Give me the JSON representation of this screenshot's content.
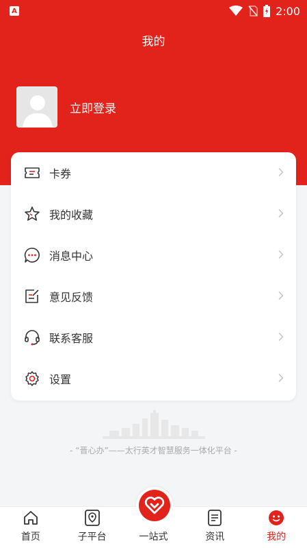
{
  "status_bar": {
    "app_badge": "A",
    "time": "2:00"
  },
  "header": {
    "title": "我的"
  },
  "profile": {
    "login_label": "立即登录"
  },
  "menu": {
    "items": [
      {
        "label": "卡券",
        "icon": "ticket-icon"
      },
      {
        "label": "我的收藏",
        "icon": "star-icon"
      },
      {
        "label": "消息中心",
        "icon": "message-icon"
      },
      {
        "label": "意见反馈",
        "icon": "feedback-icon"
      },
      {
        "label": "联系客服",
        "icon": "headset-icon"
      },
      {
        "label": "设置",
        "icon": "gear-icon"
      }
    ]
  },
  "footer": {
    "slogan": "- “晋心办”——太行英才智慧服务一体化平台 -"
  },
  "tabbar": {
    "tabs": [
      {
        "label": "首页",
        "icon": "home-icon"
      },
      {
        "label": "子平台",
        "icon": "location-icon"
      },
      {
        "label": "一站式",
        "icon": "heart-icon"
      },
      {
        "label": "资讯",
        "icon": "news-icon"
      },
      {
        "label": "我的",
        "icon": "profile-icon"
      }
    ],
    "active_index": 4
  },
  "colors": {
    "brand": "#e1231c",
    "background": "#f3f5f6"
  }
}
